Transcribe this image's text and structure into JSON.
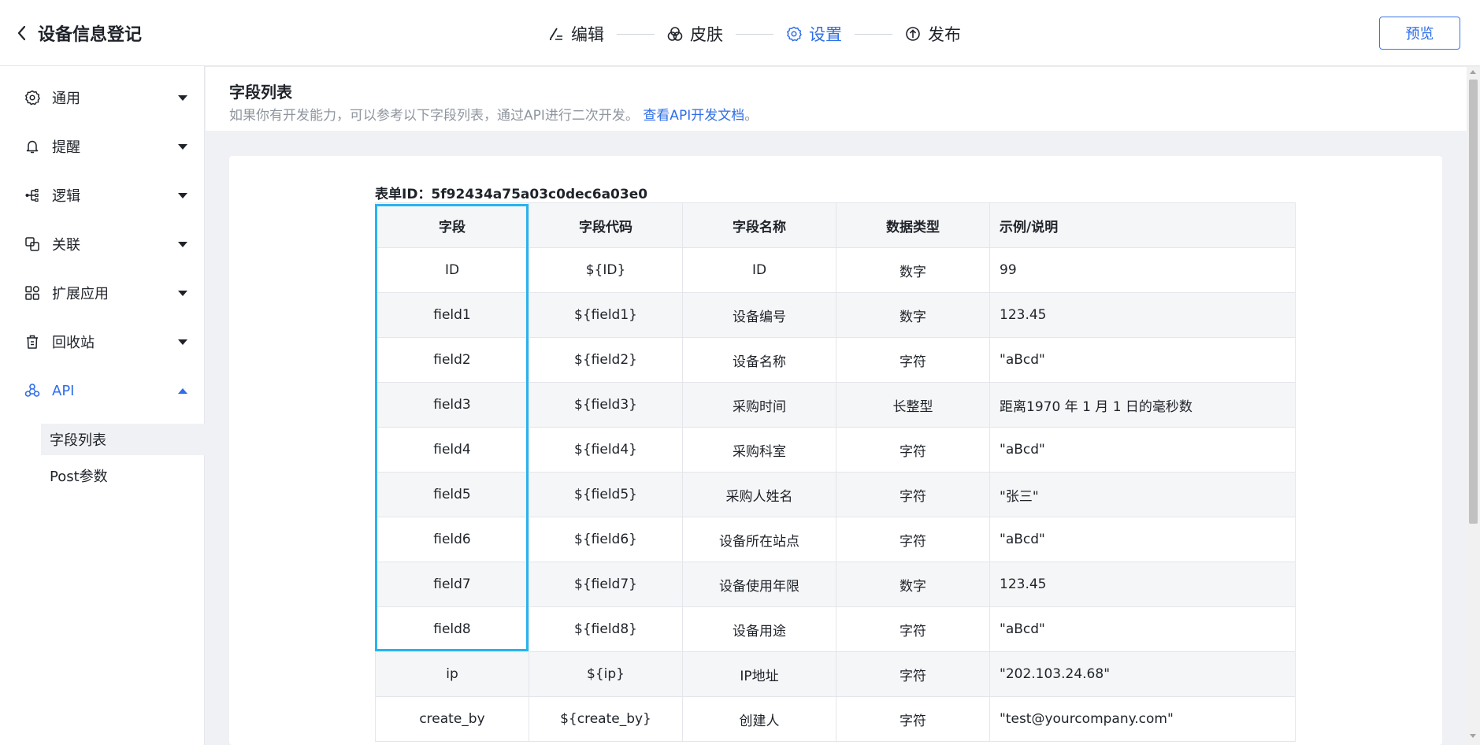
{
  "header": {
    "title": "设备信息登记",
    "steps": [
      {
        "label": "编辑",
        "icon": "edit-icon"
      },
      {
        "label": "皮肤",
        "icon": "skin-icon"
      },
      {
        "label": "设置",
        "icon": "gear-icon",
        "active": true
      },
      {
        "label": "发布",
        "icon": "publish-icon"
      }
    ],
    "preview_label": "预览"
  },
  "sidebar": {
    "items": [
      {
        "label": "通用",
        "icon": "gear-icon"
      },
      {
        "label": "提醒",
        "icon": "bell-icon"
      },
      {
        "label": "逻辑",
        "icon": "branch-icon"
      },
      {
        "label": "关联",
        "icon": "link-icon"
      },
      {
        "label": "扩展应用",
        "icon": "apps-icon"
      },
      {
        "label": "回收站",
        "icon": "trash-icon"
      },
      {
        "label": "API",
        "icon": "api-icon",
        "expanded": true
      }
    ],
    "sub_items": [
      {
        "label": "字段列表",
        "selected": true
      },
      {
        "label": "Post参数"
      }
    ]
  },
  "main": {
    "title": "字段列表",
    "description": "如果你有开发能力，可以参考以下字段列表，通过API进行二次开发。",
    "doc_link": "查看API开发文档",
    "doc_link_suffix": "。",
    "form_id_label": "表单ID：5f92434a75a03c0dec6a03e0",
    "table": {
      "headers": [
        "字段",
        "字段代码",
        "字段名称",
        "数据类型",
        "示例/说明"
      ],
      "rows": [
        [
          "ID",
          "${ID}",
          "ID",
          "数字",
          "99"
        ],
        [
          "field1",
          "${field1}",
          "设备编号",
          "数字",
          "123.45"
        ],
        [
          "field2",
          "${field2}",
          "设备名称",
          "字符",
          "\"aBcd\""
        ],
        [
          "field3",
          "${field3}",
          "采购时间",
          "长整型",
          "距离1970 年 1 月 1 日的毫秒数"
        ],
        [
          "field4",
          "${field4}",
          "采购科室",
          "字符",
          "\"aBcd\""
        ],
        [
          "field5",
          "${field5}",
          "采购人姓名",
          "字符",
          "\"张三\""
        ],
        [
          "field6",
          "${field6}",
          "设备所在站点",
          "字符",
          "\"aBcd\""
        ],
        [
          "field7",
          "${field7}",
          "设备使用年限",
          "数字",
          "123.45"
        ],
        [
          "field8",
          "${field8}",
          "设备用途",
          "字符",
          "\"aBcd\""
        ],
        [
          "ip",
          "${ip}",
          "IP地址",
          "字符",
          "\"202.103.24.68\""
        ],
        [
          "create_by",
          "${create_by}",
          "创建人",
          "字符",
          "\"test@yourcompany.com\""
        ]
      ]
    }
  },
  "colors": {
    "accent": "#2e6ee8",
    "highlight_box": "#29b3ee",
    "muted_text": "#8f959e"
  }
}
